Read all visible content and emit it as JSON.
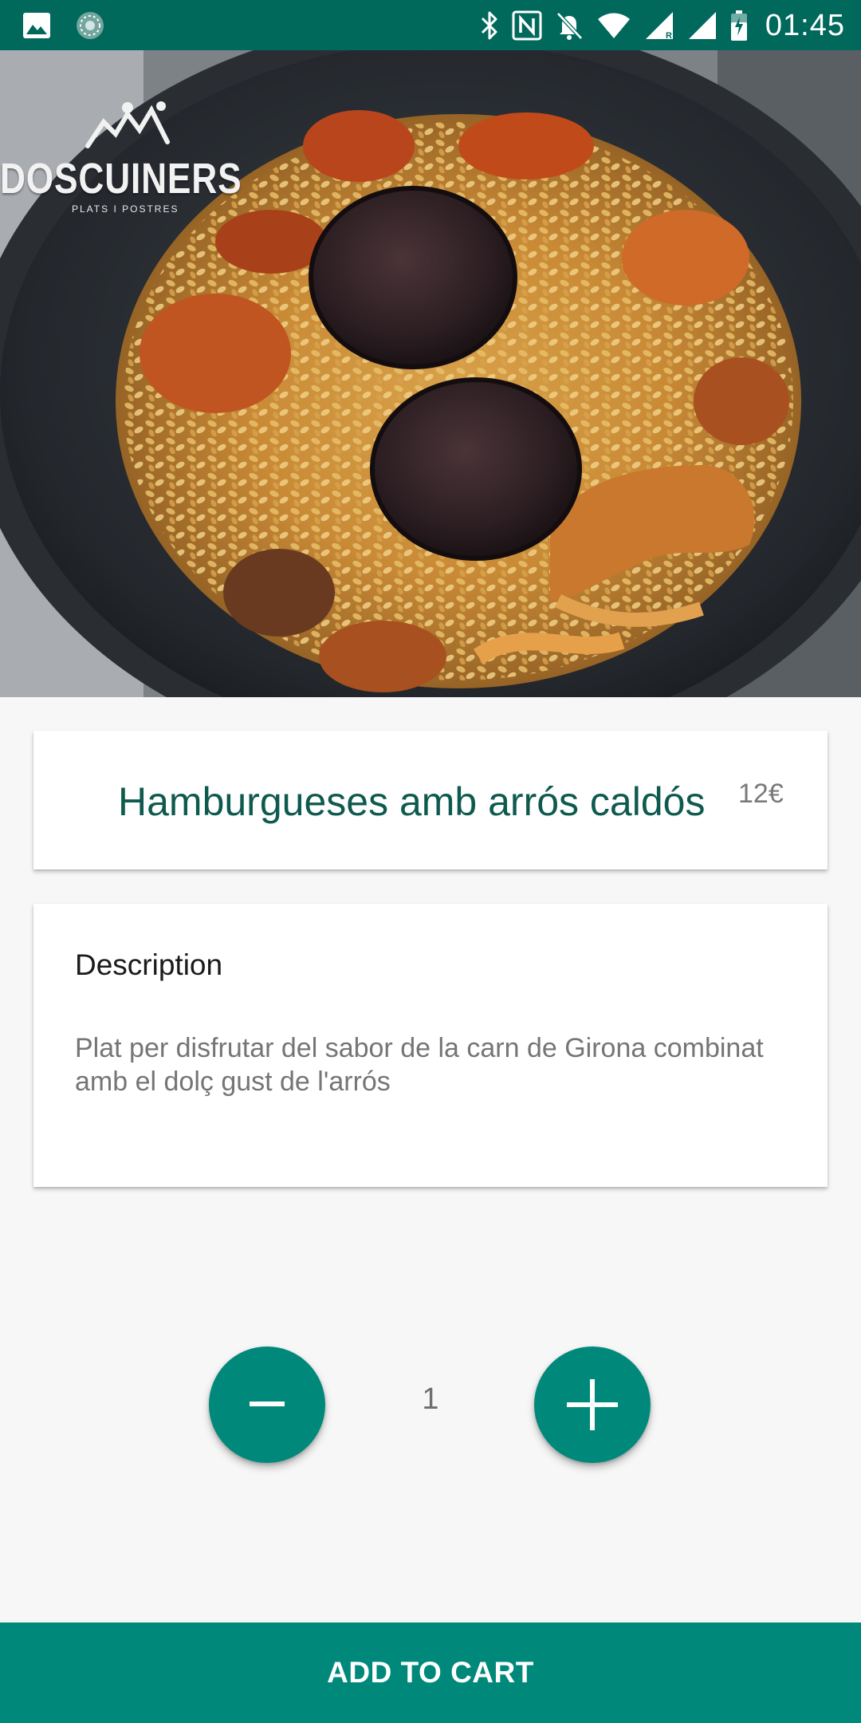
{
  "status_bar": {
    "time": "01:45",
    "left_icons": [
      "image-icon",
      "sync-icon"
    ],
    "right_icons": [
      "bluetooth-icon",
      "nfc-icon",
      "notifications-off-icon",
      "wifi-icon",
      "signal-roaming-icon",
      "signal-icon",
      "battery-charging-icon"
    ],
    "background": "#00695c"
  },
  "hero": {
    "logo_text": "DOSCUINERS",
    "logo_subtitle": "PLATS I POSTRES"
  },
  "product": {
    "title": "Hamburgueses amb arrós caldós",
    "price": "12€"
  },
  "description": {
    "heading": "Description",
    "body": "Plat per disfrutar del sabor de la carn de Girona combinat amb el dolç gust de l'arrós"
  },
  "quantity": {
    "value": "1",
    "decrement_icon": "minus-icon",
    "increment_icon": "plus-icon"
  },
  "cart": {
    "add_label": "ADD TO CART"
  },
  "colors": {
    "accent": "#00897b",
    "title_color": "#0e5a4f",
    "status_bar": "#00695c"
  }
}
